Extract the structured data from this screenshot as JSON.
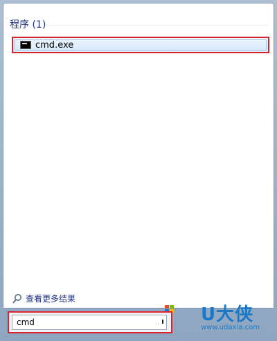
{
  "results": {
    "section_title": "程序 (1)",
    "items": [
      {
        "label": "cmd.exe",
        "icon": "cmd-icon"
      }
    ],
    "more_results_label": "查看更多结果"
  },
  "search": {
    "value": "cmd",
    "clear_hint": ".."
  },
  "watermark": {
    "brand": "U大侠",
    "url": "www.udaxia.com"
  },
  "colors": {
    "highlight_border": "#d9232d",
    "section_title": "#1e3287",
    "brand": "#1a78c8"
  }
}
